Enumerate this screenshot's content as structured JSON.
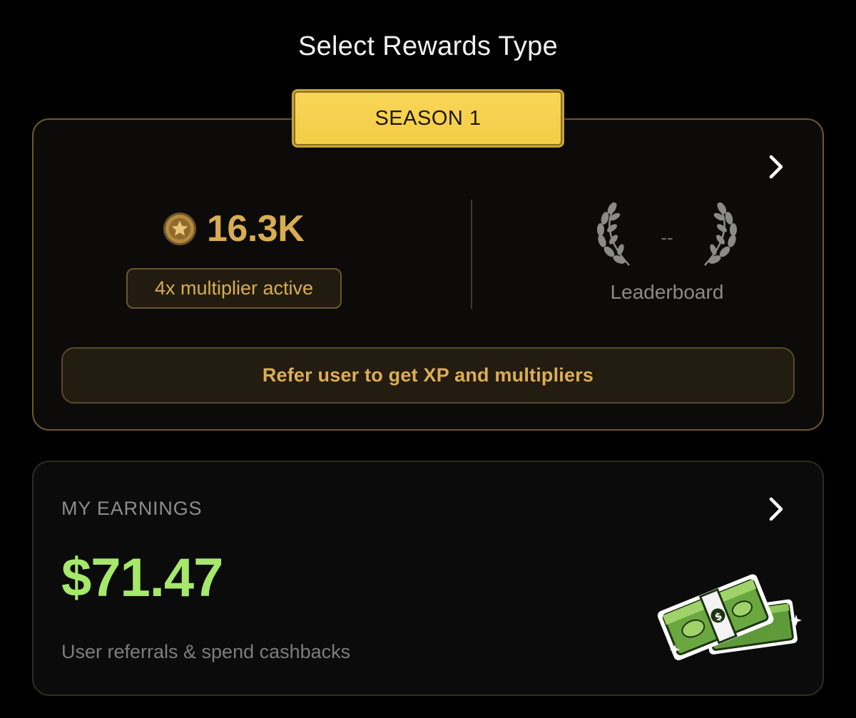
{
  "header": {
    "title": "Select Rewards Type"
  },
  "season": {
    "tab_label": "SEASON 1",
    "points": "16.3K",
    "multiplier": "4x multiplier active",
    "rank": "--",
    "leaderboard_label": "Leaderboard",
    "refer_button": "Refer user to get XP and multipliers"
  },
  "earnings": {
    "label": "MY EARNINGS",
    "amount": "$71.47",
    "subtitle": "User referrals & spend cashbacks"
  },
  "icons": {
    "coin": "star-coin-icon",
    "laurel": "laurel-wreath-icon",
    "chevron": "chevron-right-icon",
    "cash": "cash-stack-icon"
  },
  "colors": {
    "background": "#000000",
    "gold": "#d8ad52",
    "tab_yellow": "#f5cf4b",
    "earnings_green": "#a6e86a"
  }
}
